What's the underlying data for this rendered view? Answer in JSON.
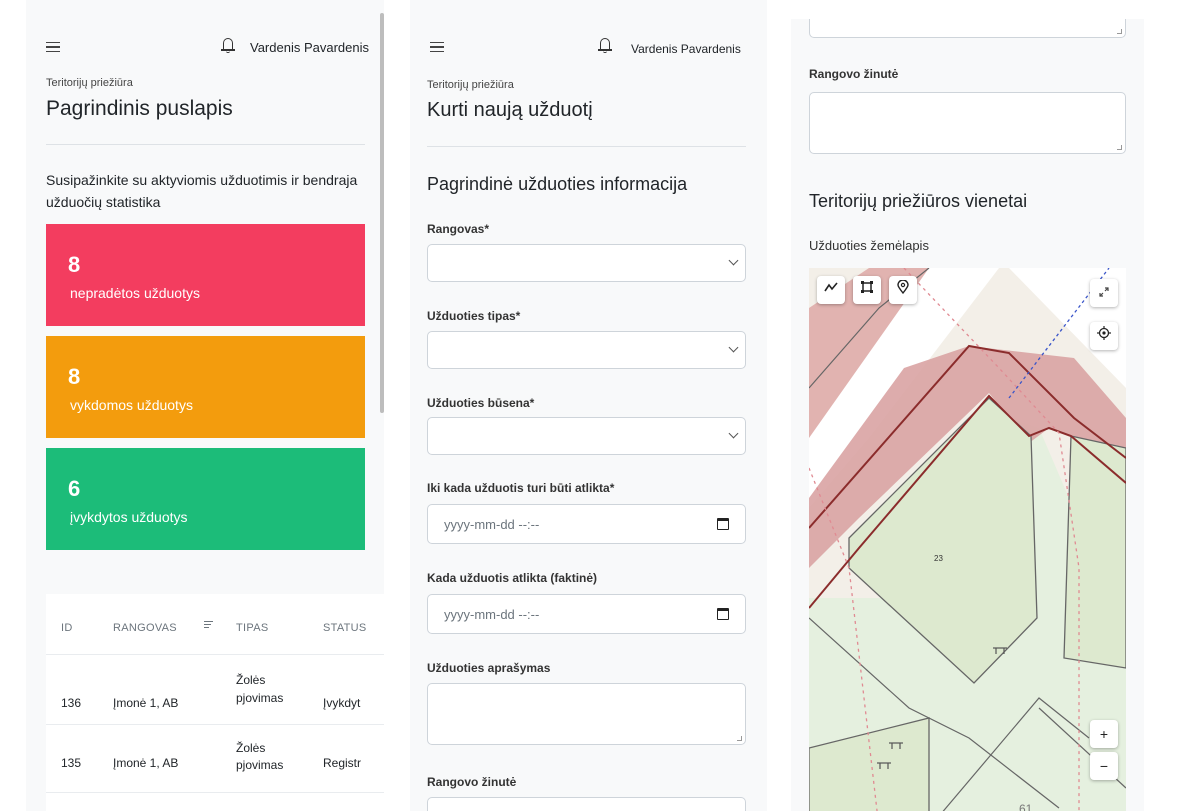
{
  "header": {
    "menu_icon": "hamburger-icon",
    "bell_icon": "bell-icon",
    "user_name": "Vardenis Pavardenis"
  },
  "dashboard": {
    "breadcrumb": "Teritorijų priežiūra",
    "title": "Pagrindinis puslapis",
    "intro": "Susipažinkite su aktyviomis užduotimis ir bendraja užduočių statistika",
    "stats": [
      {
        "count": "8",
        "label": "nepradėtos užduotys",
        "color": "#f33d5f"
      },
      {
        "count": "8",
        "label": "vykdomos užduotys",
        "color": "#f39c0d"
      },
      {
        "count": "6",
        "label": "įvykdytos užduotys",
        "color": "#1cbc79"
      }
    ],
    "table": {
      "columns": [
        "ID",
        "RANGOVAS",
        "TIPAS",
        "STATUS"
      ],
      "rows": [
        {
          "id": "136",
          "contractor": "Įmonė 1, AB",
          "type_line1": "Žolės",
          "type_line2": "pjovimas",
          "status": "Įvykdyt"
        },
        {
          "id": "135",
          "contractor": "Įmonė 1, AB",
          "type_line1": "Žolės",
          "type_line2": "pjovimas",
          "status": "Registr"
        }
      ]
    }
  },
  "create_task": {
    "breadcrumb": "Teritorijų priežiūra",
    "title": "Kurti naują užduotį",
    "section_title": "Pagrindinė užduoties informacija",
    "fields": {
      "contractor_label": "Rangovas*",
      "task_type_label": "Užduoties tipas*",
      "task_status_label": "Užduoties būsena*",
      "due_label": "Iki kada užduotis turi būti atlikta*",
      "due_placeholder": "yyyy-mm-dd --:--",
      "done_label": "Kada užduotis atlikta (faktinė)",
      "done_placeholder": "yyyy-mm-dd --:--",
      "description_label": "Užduoties aprašymas",
      "contractor_message_label": "Rangovo žinutė"
    }
  },
  "create_task_lower": {
    "contractor_message_label": "Rangovo žinutė",
    "units_title": "Teritorijų priežiūros vienetai",
    "map_label": "Užduoties žemėlapis",
    "map_numbers": [
      "23",
      "61"
    ],
    "map_tools": {
      "line_icon": "draw-line-icon",
      "polygon_icon": "draw-polygon-icon",
      "point_icon": "map-pin-icon",
      "fullscreen_icon": "fullscreen-icon",
      "locate_icon": "locate-icon",
      "zoom_in": "+",
      "zoom_out": "−"
    }
  }
}
